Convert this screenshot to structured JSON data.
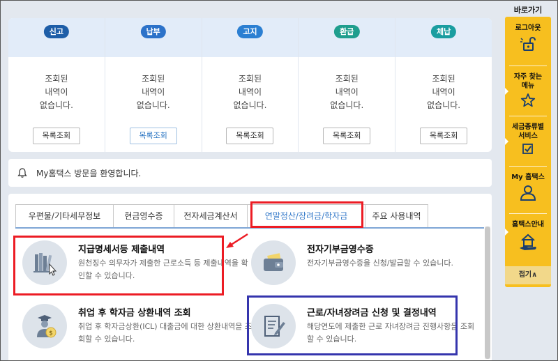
{
  "status_panel": {
    "columns": [
      {
        "badge": "신고",
        "color": "#1e5ea8",
        "msg": [
          "조회된",
          "내역이",
          "없습니다."
        ],
        "button": "목록조회"
      },
      {
        "badge": "납부",
        "color": "#2c72c9",
        "msg": [
          "조회된",
          "내역이",
          "없습니다."
        ],
        "button": "목록조회"
      },
      {
        "badge": "고지",
        "color": "#2b7fd2",
        "msg": [
          "조회된",
          "내역이",
          "없습니다."
        ],
        "button": "목록조회"
      },
      {
        "badge": "환급",
        "color": "#1f9e8e",
        "msg": [
          "조회된",
          "내역이",
          "없습니다."
        ],
        "button": "목록조회"
      },
      {
        "badge": "체납",
        "color": "#1a9da0",
        "msg": [
          "조회된",
          "내역이",
          "없습니다."
        ],
        "button": "목록조회"
      }
    ]
  },
  "welcome": {
    "text": "My홈택스 방문을 환영합니다."
  },
  "tabs": [
    "우편물/기타세무정보",
    "현금영수증",
    "전자세금계산서",
    "연말정산/장려금/학자금",
    "주요 사용내역"
  ],
  "items": [
    {
      "title": "지급명세서등 제출내역",
      "desc": "원천징수 의무자가 제출한 근로소득 등 제출내역을 확인할 수 있습니다.",
      "icon": "books-icon"
    },
    {
      "title": "전자기부금영수증",
      "desc": "전자기부금영수증을 신청/발급할 수 있습니다.",
      "icon": "wallet-icon"
    },
    {
      "title": "취업 후 학자금 상환내역 조회",
      "desc": "취업 후 학자금상환(ICL) 대출금에 대한 상환내역을 조회할 수 있습니다.",
      "icon": "graduate-icon"
    },
    {
      "title": "근로/자녀장려금 신청 및 결정내역",
      "desc": "해당연도에 제출한 근로 자녀장려금 진행사항을 조회할 수 있습니다.",
      "icon": "document-pen-icon"
    }
  ],
  "quick": {
    "title": "바로가기",
    "items": [
      {
        "label": "로그아웃",
        "icon": "unlock-icon"
      },
      {
        "label": "자주 찾는 메뉴",
        "icon": "star-icon"
      },
      {
        "label": "세금종류별 서비스",
        "icon": "checkbox-icon"
      },
      {
        "label": "My 홈택스",
        "icon": "user-icon"
      },
      {
        "label": "홈택스안내",
        "icon": "house-hand-icon"
      }
    ],
    "collapse": "접기∧"
  },
  "colors": {
    "accent": "#3479c9",
    "highlight_red": "#ec1c24",
    "highlight_blue": "#3535ad",
    "quick_bar": "#f7bf1f"
  }
}
